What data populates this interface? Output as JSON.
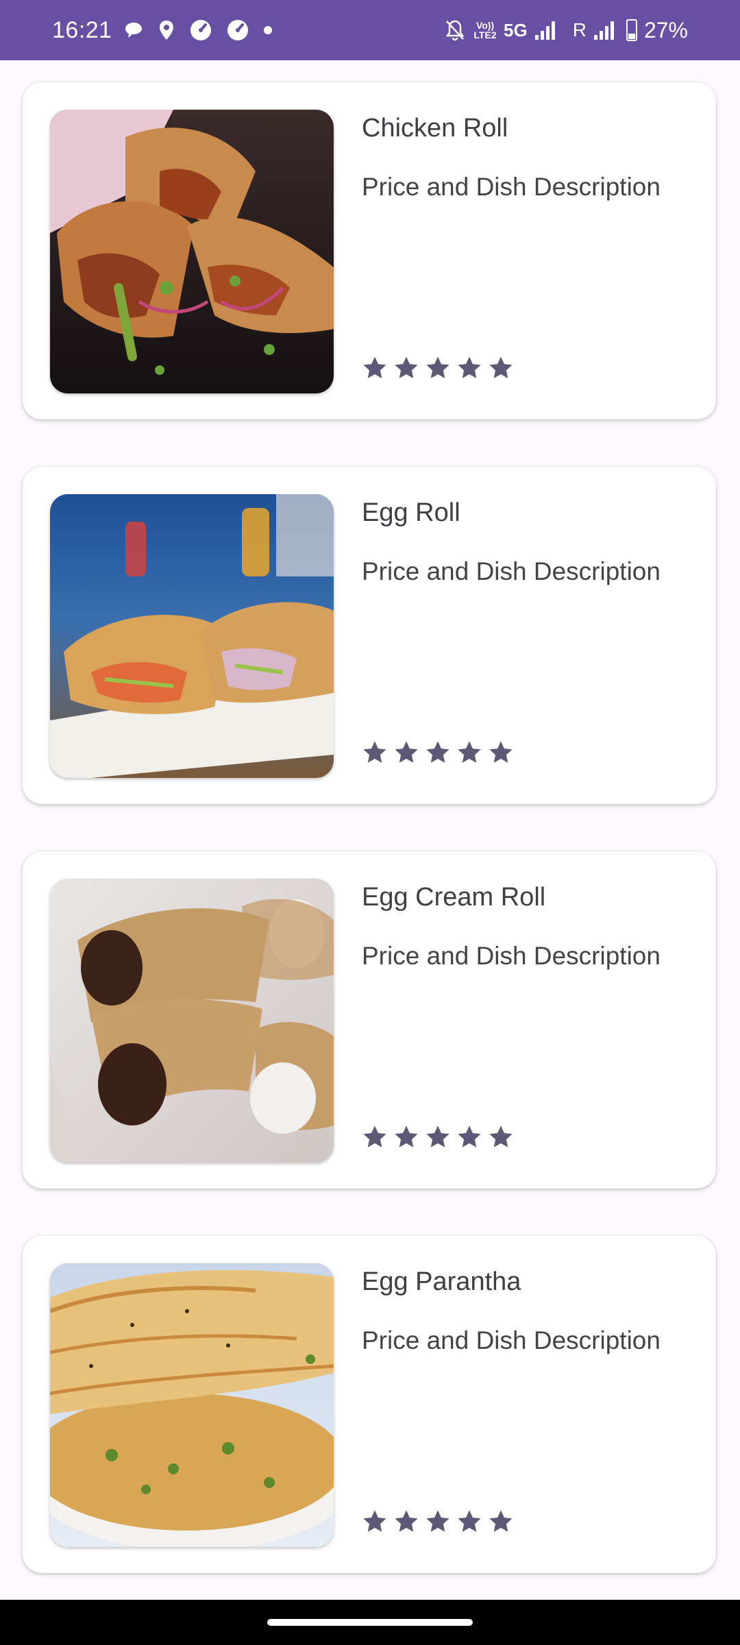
{
  "status_bar": {
    "time": "16:21",
    "left_icons": [
      "chat-bubble-icon",
      "location-pin-icon",
      "speed-gauge-icon",
      "speed-gauge-icon",
      "dot-icon"
    ],
    "volte_top": "Vo))",
    "volte_bottom": "LTE2",
    "network": "5G",
    "roaming": "R",
    "battery": "27%",
    "bg_color": "#6750a4"
  },
  "dishes": [
    {
      "title": "Chicken Roll",
      "description": "Price and Dish Description",
      "rating": 5,
      "image": "chicken-roll-photo"
    },
    {
      "title": "Egg Roll",
      "description": "Price and Dish Description",
      "rating": 5,
      "image": "egg-roll-photo"
    },
    {
      "title": "Egg Cream Roll",
      "description": "Price and Dish Description",
      "rating": 5,
      "image": "egg-cream-roll-photo"
    },
    {
      "title": "Egg Parantha",
      "description": "Price and Dish Description",
      "rating": 5,
      "image": "egg-parantha-photo"
    }
  ],
  "colors": {
    "star": "#5d5874",
    "card_bg": "#ffffff",
    "page_bg": "#fcf8fd"
  }
}
